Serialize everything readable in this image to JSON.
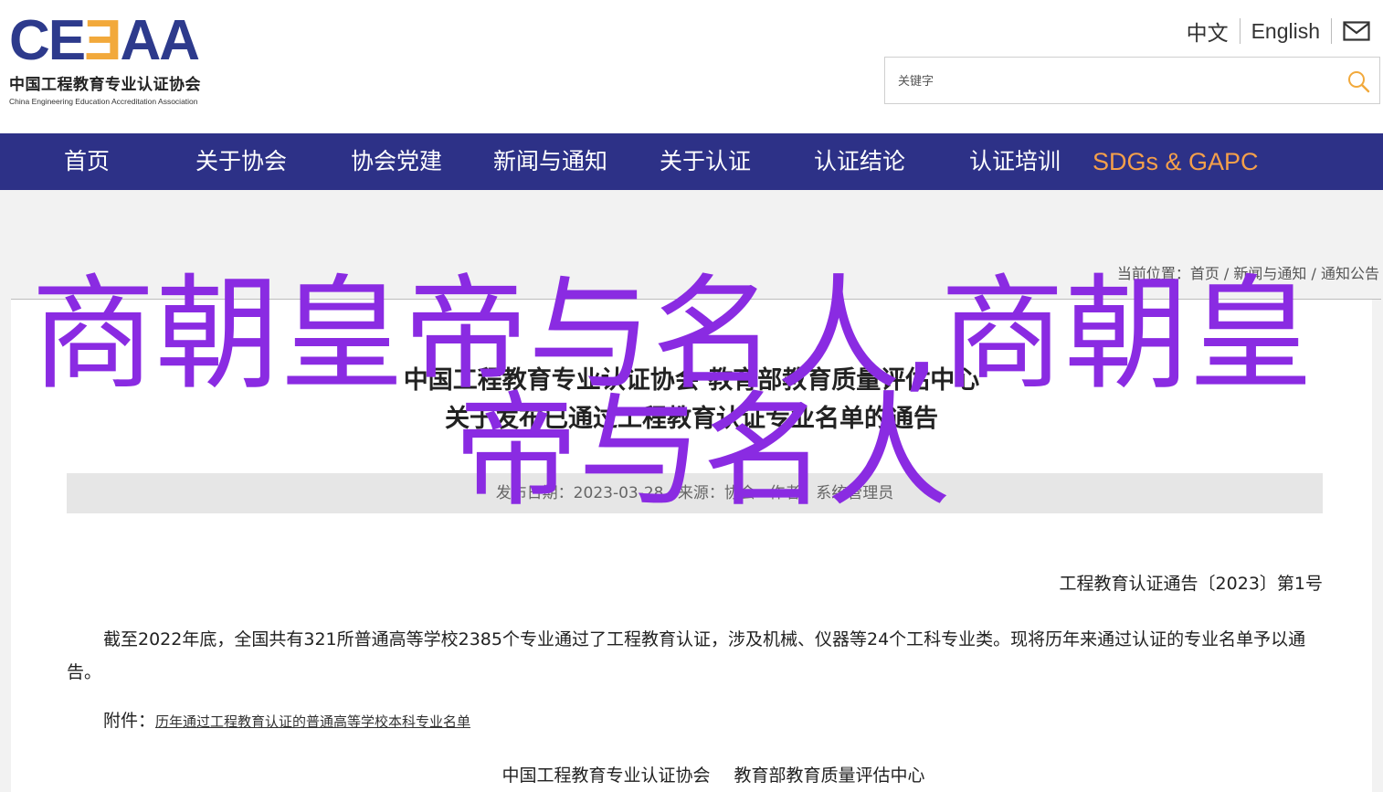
{
  "header": {
    "logo_mark_a": "C",
    "logo_mark_b": "E",
    "logo_mark_e3": "Ǝ",
    "logo_mark_c": "AA",
    "logo_cn": "中国工程教育专业认证协会",
    "logo_en": "China Engineering Education Accreditation Association",
    "lang_zh": "中文",
    "lang_en": "English",
    "mail_icon": "envelope-icon",
    "search_placeholder": "关键字",
    "search_icon": "magnifier-icon"
  },
  "nav": {
    "items": [
      {
        "label": "首页"
      },
      {
        "label": "关于协会"
      },
      {
        "label": "协会党建"
      },
      {
        "label": "新闻与通知"
      },
      {
        "label": "关于认证"
      },
      {
        "label": "认证结论"
      },
      {
        "label": "认证培训"
      },
      {
        "label": "SDGs & GAPC"
      }
    ]
  },
  "breadcrumb": {
    "prefix": "当前位置：",
    "items": [
      "首页",
      "新闻与通知",
      "通知公告"
    ],
    "separator": " / "
  },
  "article": {
    "title_line1": "中国工程教育专业认证协会 教育部教育质量评估中心",
    "title_line2": "关于发布已通过工程教育认证专业名单的通告",
    "meta_date": "发布日期：2023-03-28",
    "meta_source": "来源：协会",
    "meta_author": "作者：系统管理员",
    "doc_no": "工程教育认证通告〔2023〕第1号",
    "body": "截至2022年底，全国共有321所普通高等学校2385个专业通过了工程教育认证，涉及机械、仪器等24个工科专业类。现将历年来通过认证的专业名单予以通告。",
    "attach_label": "附件：",
    "attach_link": "历年通过工程教育认证的普通高等学校本科专业名单",
    "sign1": "中国工程教育专业认证协会",
    "sign2": "教育部教育质量评估中心"
  },
  "overlay": {
    "line1": "商朝皇帝与名人,商朝皇",
    "line2": "帝与名人"
  },
  "colors": {
    "brand_navy": "#2d3187",
    "brand_orange": "#f5a04a",
    "overlay_purple": "#8a2be2"
  }
}
